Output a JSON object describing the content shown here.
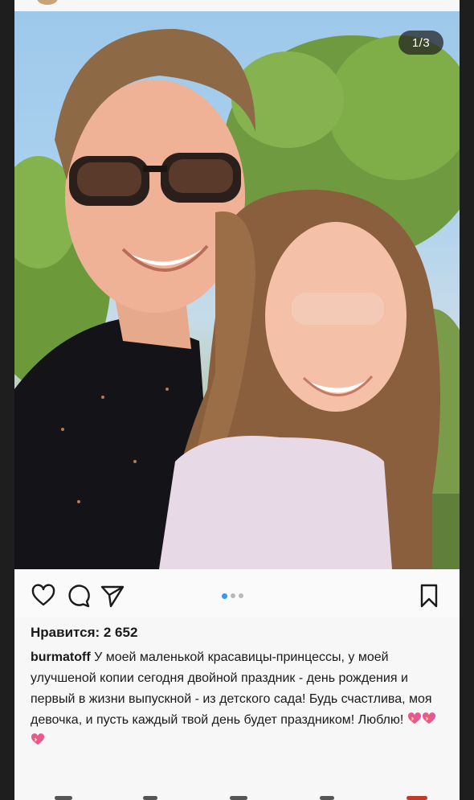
{
  "post": {
    "slide_counter": "1/3",
    "carousel": {
      "total": 3,
      "current": 1
    },
    "likes_text": "Нравится: 2 652",
    "username": "burmatoff",
    "caption_text": "У моей маленькой красавицы-принцессы, у моей улучшеной копии сегодня двойной праздник - день рождения и первый в жизни выпускной - из детского сада! Будь счастлива, моя девочка, и пусть каждый твой день будет праздником! Люблю!"
  },
  "icons": {
    "like": "heart-outline-icon",
    "comment": "comment-bubble-icon",
    "share": "paper-plane-icon",
    "save": "bookmark-outline-icon",
    "caption_emoji": "sparkling-heart-emoji"
  },
  "colors": {
    "active_dot": "#3b97e8",
    "inactive_dot": "#b9b9b9",
    "text": "#1a1a1a",
    "card_bg": "#f7f7f7"
  }
}
